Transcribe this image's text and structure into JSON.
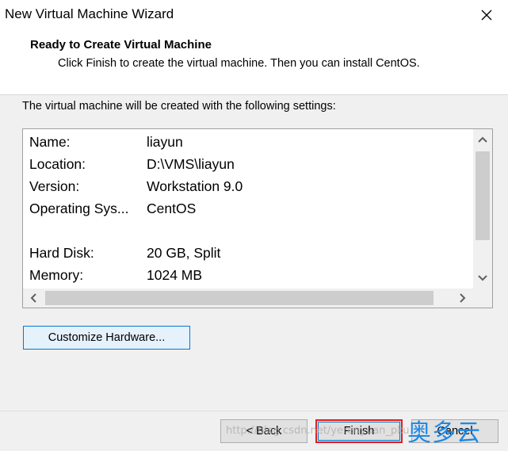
{
  "window": {
    "title": "New Virtual Machine Wizard",
    "close_icon": "close-icon"
  },
  "header": {
    "title": "Ready to Create Virtual Machine",
    "subtitle": "Click Finish to create the virtual machine. Then you can install CentOS."
  },
  "intro": "The virtual machine will be created with the following settings:",
  "settings": [
    {
      "key": "Name:",
      "value": "liayun"
    },
    {
      "key": "Location:",
      "value": "D:\\VMS\\liayun"
    },
    {
      "key": "Version:",
      "value": "Workstation 9.0"
    },
    {
      "key": "Operating Sys...",
      "value": "CentOS"
    },
    {
      "key": "",
      "value": ""
    },
    {
      "key": "Hard Disk:",
      "value": "20 GB, Split"
    },
    {
      "key": "Memory:",
      "value": "1024 MB"
    }
  ],
  "buttons": {
    "customize": "Customize Hardware...",
    "back": "< Back",
    "finish": "Finish",
    "cancel": "Cancel"
  },
  "overlay": {
    "watermark": "http://blog.csdn.net/yerenyuan_pku",
    "logo": "奥多云"
  },
  "colors": {
    "accent": "#0078d7",
    "highlight": "#e02020",
    "logo": "#1e88e5"
  }
}
